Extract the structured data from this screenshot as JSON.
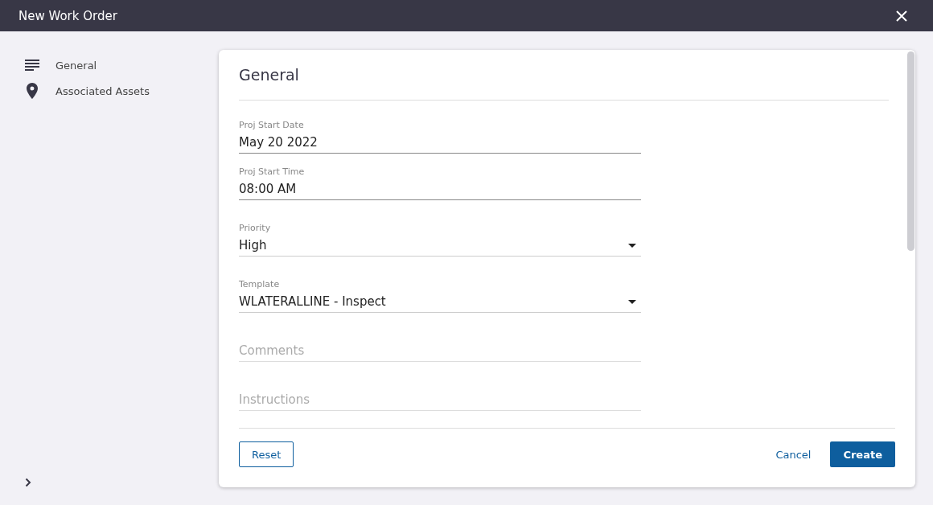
{
  "window": {
    "title": "New Work Order"
  },
  "sidebar": {
    "items": [
      {
        "label": "General",
        "kind": "section"
      },
      {
        "label": "Associated Assets",
        "kind": "location"
      }
    ]
  },
  "section": {
    "title": "General"
  },
  "fields": [
    {
      "kind": "text",
      "label": "Proj Start Date",
      "value": "May 20 2022"
    },
    {
      "kind": "text",
      "label": "Proj Start Time",
      "value": "08:00 AM"
    },
    {
      "kind": "select",
      "label": "Priority",
      "value": "High"
    },
    {
      "kind": "select",
      "label": "Template",
      "value": "WLATERALLINE - Inspect"
    },
    {
      "kind": "empty",
      "placeholder": "Comments"
    },
    {
      "kind": "empty",
      "placeholder": "Instructions"
    }
  ],
  "buttons": {
    "reset": "Reset",
    "cancel": "Cancel",
    "create": "Create"
  }
}
